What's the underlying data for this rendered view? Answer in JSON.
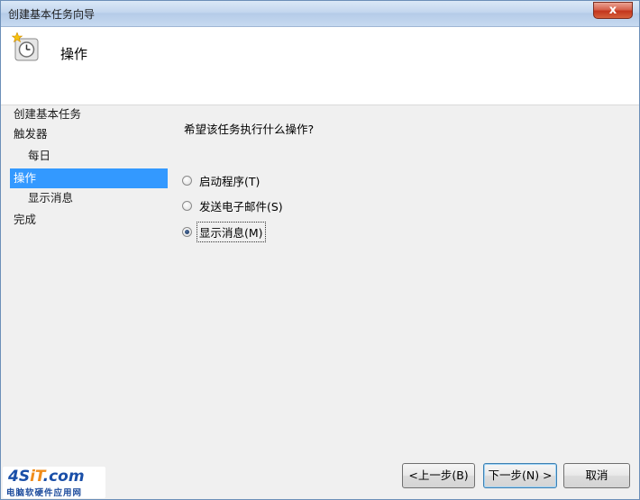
{
  "window": {
    "title": "创建基本任务向导",
    "close_symbol": "x"
  },
  "header": {
    "title": "操作",
    "icon": "task-clock-icon"
  },
  "sidebar": {
    "items": [
      {
        "label": "创建基本任务",
        "selected": false
      },
      {
        "label": "触发器",
        "selected": false
      },
      {
        "label": "每日",
        "selected": false
      },
      {
        "label": "操作",
        "selected": true
      },
      {
        "label": "显示消息",
        "selected": false
      },
      {
        "label": "完成",
        "selected": false
      }
    ]
  },
  "main": {
    "prompt": "希望该任务执行什么操作?",
    "options": [
      {
        "label": "启动程序(T)",
        "checked": false
      },
      {
        "label": "发送电子邮件(S)",
        "checked": false
      },
      {
        "label": "显示消息(M)",
        "checked": true
      }
    ]
  },
  "buttons": {
    "back": "<上一步(B)",
    "next": "下一步(N) >",
    "cancel": "取消"
  },
  "watermark": {
    "logo_a": "4S",
    "logo_b": "iT",
    "logo_c": ".com",
    "subtitle": "电脑软硬件应用网"
  },
  "colors": {
    "selection": "#3399ff",
    "titlebar": "#c3d6ee",
    "close": "#c3361e"
  }
}
